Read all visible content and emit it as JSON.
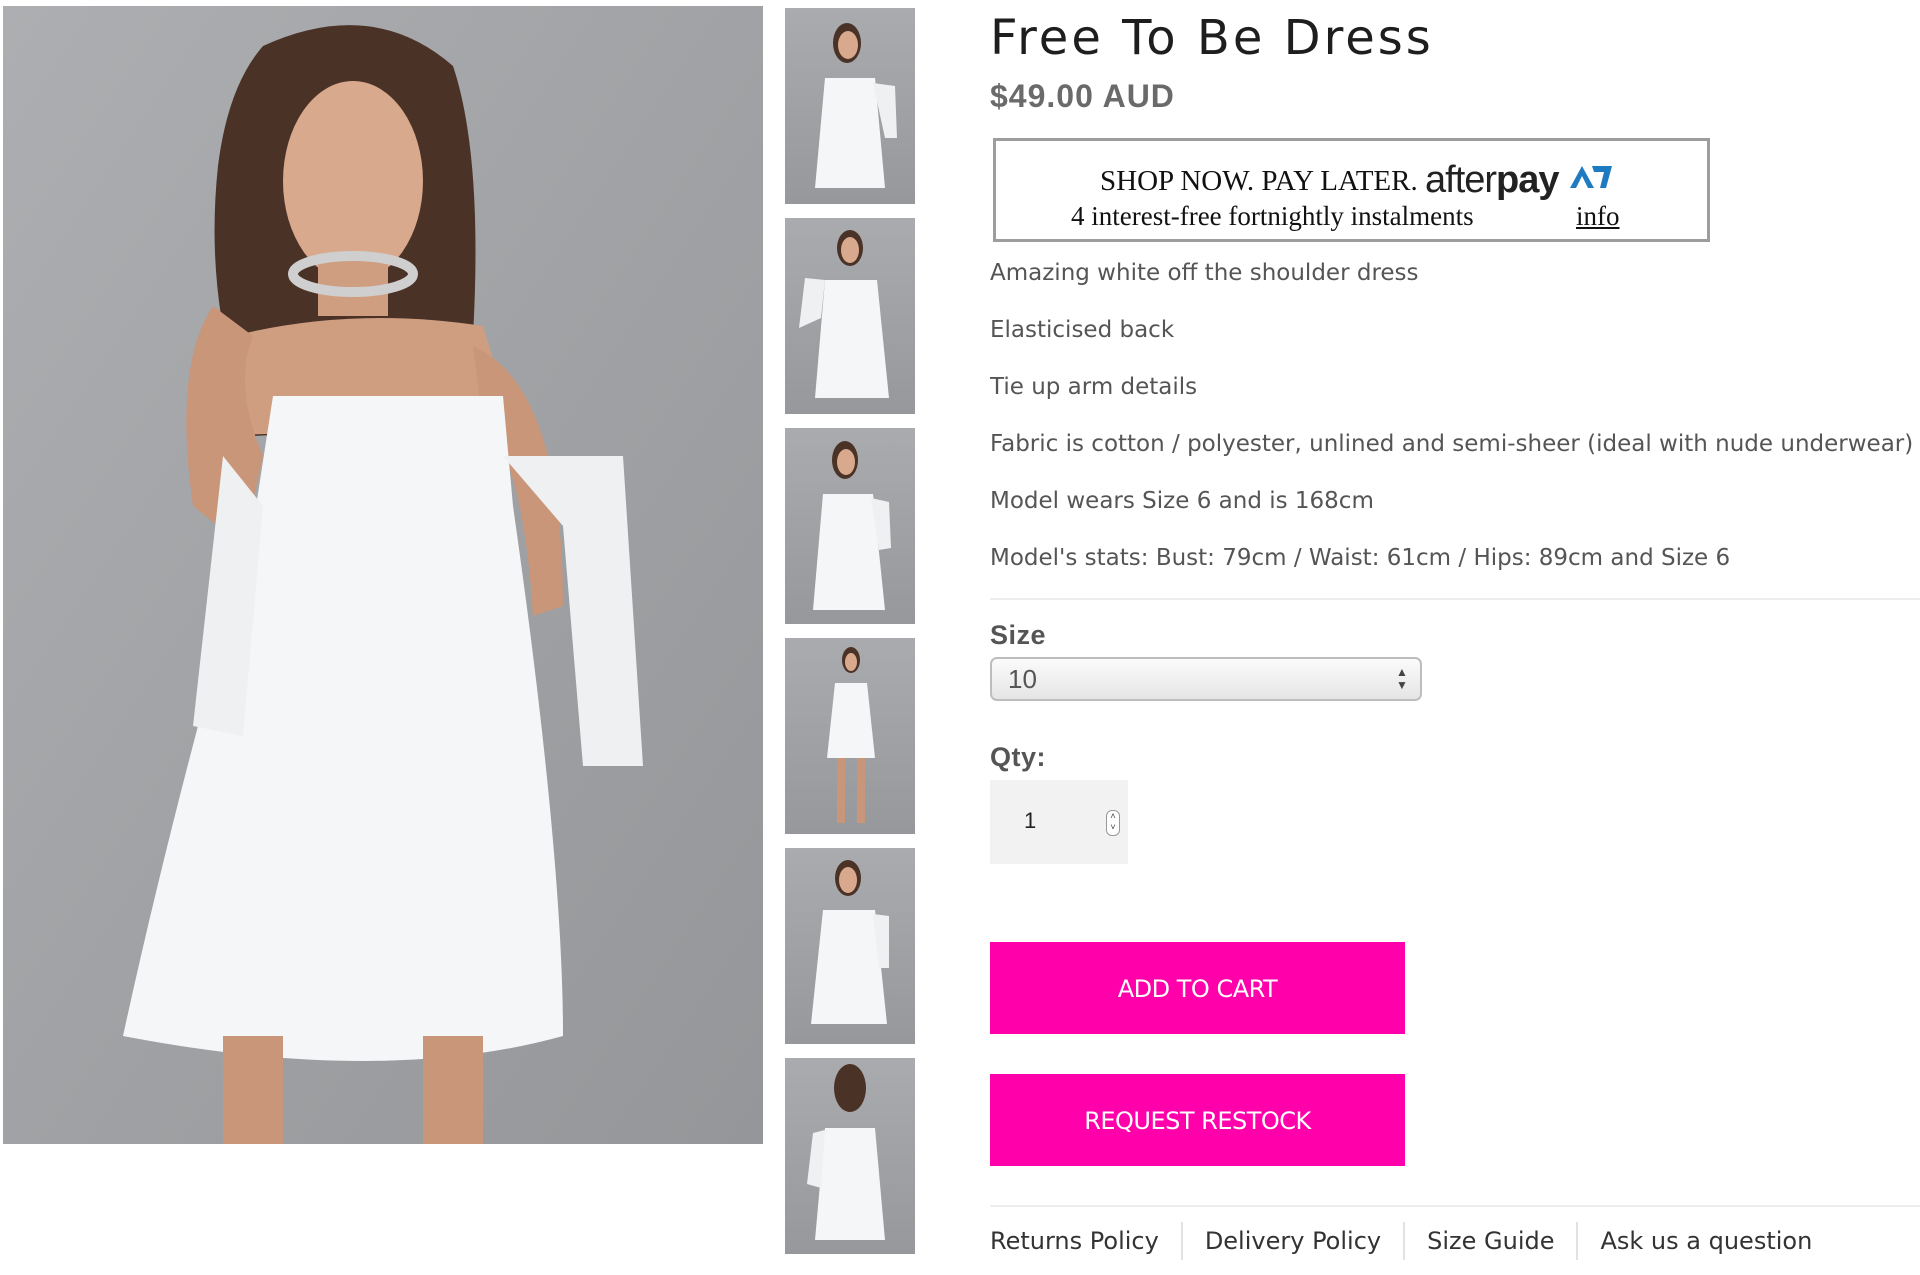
{
  "product": {
    "title": "Free To Be Dress",
    "price": "$49.00 AUD"
  },
  "afterpay": {
    "headline": "SHOP NOW.  PAY LATER.",
    "logo_light": "after",
    "logo_bold": "pay",
    "subline": "4 interest-free fortnightly instalments",
    "info_link": "info",
    "mark_color": "#1f7bc1"
  },
  "description": [
    "Amazing white off the shoulder dress",
    "Elasticised back",
    "Tie up arm details",
    "Fabric is cotton / polyester, unlined and semi-sheer (ideal with nude underwear)",
    "Model wears Size 6 and is 168cm",
    "Model's stats: Bust: 79cm / Waist: 61cm / Hips: 89cm and Size 6"
  ],
  "size": {
    "label": "Size",
    "selected": "10"
  },
  "qty": {
    "label": "Qty:",
    "value": "1"
  },
  "buttons": {
    "add_to_cart": "ADD TO CART",
    "request_restock": "REQUEST RESTOCK",
    "color": "#ff00aa"
  },
  "policies": [
    "Returns Policy",
    "Delivery Policy",
    "Size Guide",
    "Ask us a question"
  ],
  "gallery": {
    "main_image": "model-in-white-off-shoulder-dress",
    "thumbnails": [
      "front-view",
      "front-view-arms-out",
      "three-quarter-view",
      "full-length-view",
      "front-view-alt",
      "back-view"
    ]
  }
}
